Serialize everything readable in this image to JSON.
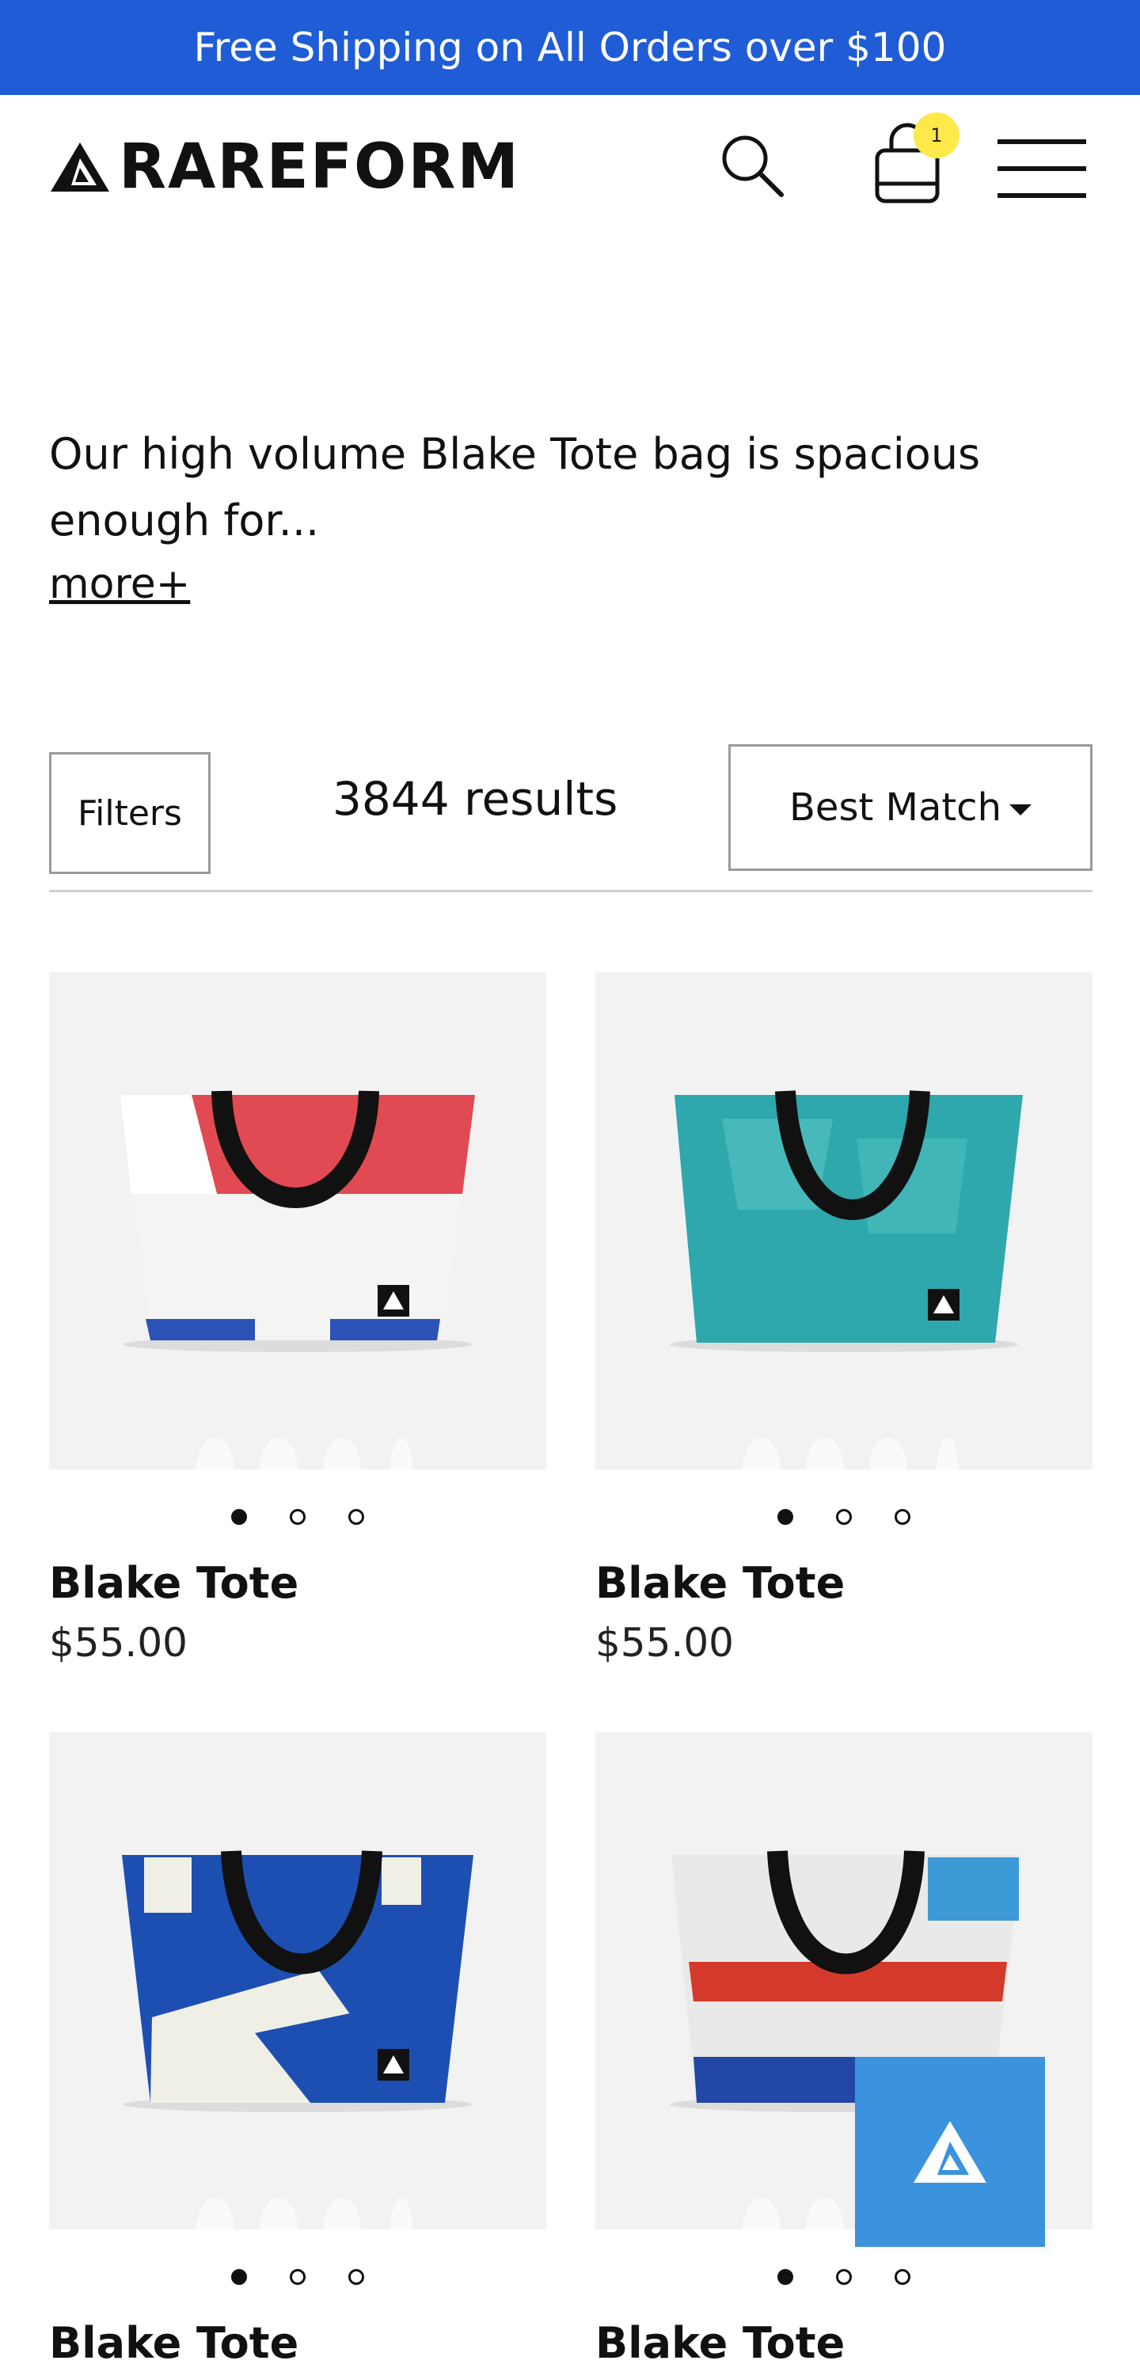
{
  "promo": {
    "text": "Free Shipping on All Orders over $100"
  },
  "header": {
    "brand": "RAREFORM",
    "cart_count": "1",
    "icons": [
      "brand-logo-icon",
      "search-icon",
      "shopping-bag-icon",
      "hamburger-menu-icon"
    ]
  },
  "collection": {
    "description": "Our high volume Blake Tote bag is spacious enough for...",
    "more_label": "more+"
  },
  "toolbar": {
    "filters_label": "Filters",
    "results_text": "3844 results",
    "sort_label": "Best Match"
  },
  "products": [
    {
      "title": "Blake Tote",
      "price": "$55.00",
      "colors": [
        "#ffffff",
        "#e14a52",
        "#2d52b8"
      ]
    },
    {
      "title": "Blake Tote",
      "price": "$55.00",
      "colors": [
        "#2ea8ac",
        "#2ea8ac",
        "#2ea8ac"
      ]
    },
    {
      "title": "Blake Tote",
      "price": "",
      "colors": [
        "#1d4fb3",
        "#f0efe6",
        "#1d4fb3"
      ]
    },
    {
      "title": "Blake Tote",
      "price": "",
      "colors": [
        "#e9e9e9",
        "#d43a2b",
        "#2247a6"
      ]
    }
  ],
  "colors": {
    "promo_bg": "#1f5cd6",
    "badge_bg": "#ffe94a",
    "chat_widget_bg": "#3a93dc"
  }
}
